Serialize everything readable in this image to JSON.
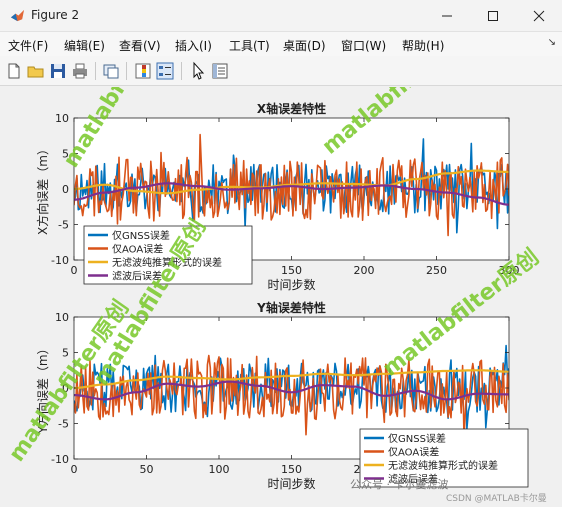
{
  "window": {
    "title": "Figure 2"
  },
  "menu": [
    "文件(F)",
    "编辑(E)",
    "查看(V)",
    "插入(I)",
    "工具(T)",
    "桌面(D)",
    "窗口(W)",
    "帮助(H)"
  ],
  "toolbar_icons": [
    "new-figure-icon",
    "open-icon",
    "save-icon",
    "print-icon",
    "link-icon",
    "insert-colorbar-icon",
    "insert-legend-icon",
    "pointer-icon",
    "property-editor-icon"
  ],
  "watermarks": [
    "matlabfilter原创",
    "matlabfilter原创",
    "matlabfilter原创",
    "matlabfilter原创",
    "matlabfilter原创"
  ],
  "credit": {
    "wechat": "公众号 · 卡尔曼滤波",
    "csdn": "CSDN @MATLAB卡尔曼"
  },
  "colors": {
    "gnss": "#0072bd",
    "aoa": "#d95319",
    "pure": "#edb120",
    "filtered": "#7e2f8e"
  },
  "chart_data": [
    {
      "type": "line",
      "title": "X轴误差特性",
      "xlabel": "时间步数",
      "ylabel": "X方向误差（m）",
      "xlim": [
        0,
        300
      ],
      "ylim": [
        -10,
        10
      ],
      "xticks": [
        0,
        50,
        100,
        150,
        200,
        250,
        300
      ],
      "yticks": [
        -10,
        -5,
        0,
        5,
        10
      ],
      "legend_position": "bottom-left",
      "series": [
        {
          "name": "仅GNSS误差",
          "color": "#0072bd",
          "amp": 2.2,
          "seed": 11
        },
        {
          "name": "仅AOA误差",
          "color": "#d95319",
          "amp": 2.8,
          "seed": 23
        },
        {
          "name": "无滤波纯推算形式的误差",
          "color": "#edb120",
          "smooth": [
            0,
            0.6,
            -0.3,
            -0.6,
            -0.1,
            0.3,
            0.2,
            0.6,
            0.8,
            0.7,
            0.5,
            1.4,
            2.2,
            2.6,
            2.4
          ]
        },
        {
          "name": "滤波后误差",
          "color": "#7e2f8e",
          "smooth": [
            -1.5,
            -0.5,
            0.2,
            0.8,
            0.4,
            -0.1,
            0.1,
            0.4,
            0.0,
            0.2,
            0.5,
            0.0,
            -0.5,
            -1.2,
            -2.2
          ]
        }
      ]
    },
    {
      "type": "line",
      "title": "Y轴误差特性",
      "xlabel": "时间步数",
      "ylabel": "Y方向误差（m）",
      "xlim": [
        0,
        300
      ],
      "ylim": [
        -10,
        10
      ],
      "xticks": [
        0,
        50,
        100,
        150,
        200,
        250,
        300
      ],
      "yticks": [
        -10,
        -5,
        0,
        5,
        10
      ],
      "legend_position": "bottom-right",
      "series": [
        {
          "name": "仅GNSS误差",
          "color": "#0072bd",
          "amp": 2.2,
          "seed": 37
        },
        {
          "name": "仅AOA误差",
          "color": "#d95319",
          "amp": 2.8,
          "seed": 53
        },
        {
          "name": "无滤波纯推算形式的误差",
          "color": "#edb120",
          "smooth": [
            0,
            0.5,
            1.1,
            1.6,
            1.4,
            1.2,
            1.5,
            1.7,
            2.0,
            1.8,
            2.0,
            2.2,
            2.4,
            2.5,
            2.3
          ]
        },
        {
          "name": "滤波后误差",
          "color": "#7e2f8e",
          "smooth": [
            -1.0,
            -1.6,
            -0.6,
            0.6,
            0.2,
            0.9,
            0.3,
            -0.6,
            0.4,
            0.2,
            -1.1,
            -0.4,
            -1.6,
            -0.8,
            -0.9
          ]
        }
      ]
    }
  ]
}
